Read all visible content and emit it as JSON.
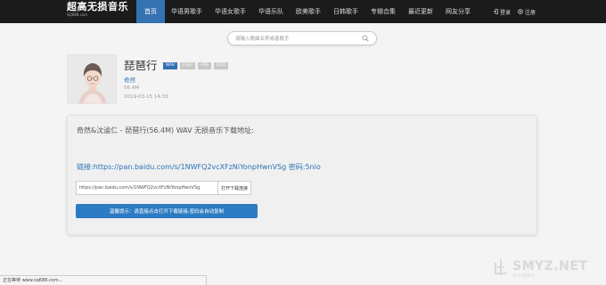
{
  "brand": {
    "name": "超高无损音乐",
    "sub": "SQ688.com"
  },
  "nav": {
    "items": [
      {
        "label": "首页",
        "active": true
      },
      {
        "label": "华语男歌手",
        "active": false
      },
      {
        "label": "华语女歌手",
        "active": false
      },
      {
        "label": "华语乐队",
        "active": false
      },
      {
        "label": "欧美歌手",
        "active": false
      },
      {
        "label": "日韩歌手",
        "active": false
      },
      {
        "label": "专辑合集",
        "active": false
      },
      {
        "label": "最近更新",
        "active": false
      },
      {
        "label": "网友分享",
        "active": false
      }
    ]
  },
  "auth": {
    "login": "登录",
    "register": "注册"
  },
  "search": {
    "placeholder": "请输入歌曲名称或者歌手",
    "icon": "search-icon"
  },
  "song": {
    "title": "琵琶行",
    "badges": [
      {
        "label": "WAV",
        "active": true
      },
      {
        "label": "FLAC",
        "active": false
      },
      {
        "label": "APE",
        "active": false
      },
      {
        "label": "DSD",
        "active": false
      }
    ],
    "artist": "奇然",
    "size": "56.4M",
    "date": "2019-03-15 14:33"
  },
  "download": {
    "heading": "奇然&沈谧仁 - 琵琶行(56.4M) WAV 无损音乐下载地址:",
    "link_text": "链接:https://pan.baidu.com/s/1NWFQ2vcXFzNiYonpHwnVSg 密码:5nio",
    "input_value": "https://pan.baidu.com/s/1NWFQ2vcXFzNiYonpHwnVSg",
    "copy_button": "打开下载连接",
    "tip_button": "温馨提示：请直接点击打开下载链接,密码会自动复制"
  },
  "statusbar": {
    "text": "正在等待 www.sq688.com..."
  },
  "watermark": {
    "text": "SMYZ.NET",
    "sub": "什么值得买"
  },
  "colors": {
    "accent": "#3572b3",
    "topbar": "#1b1b1b",
    "link": "#2a74b8"
  }
}
